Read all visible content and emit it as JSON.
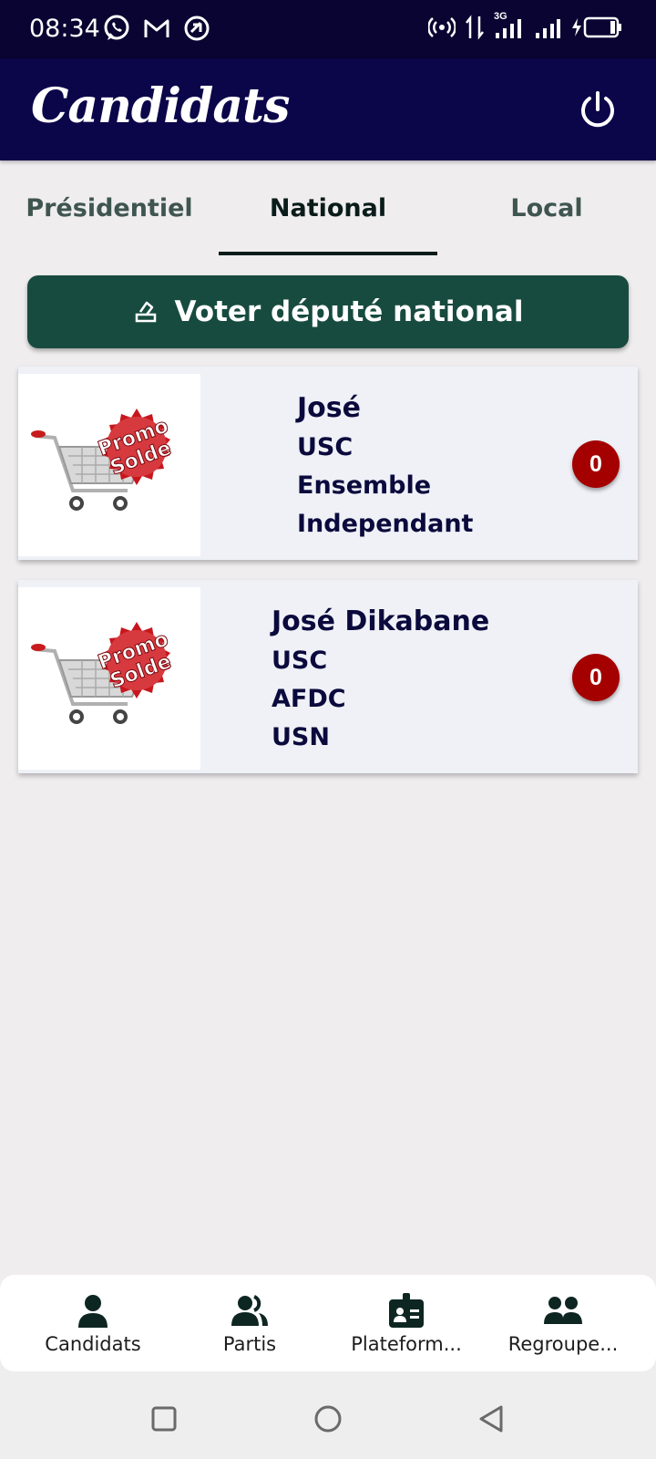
{
  "status_bar": {
    "time": "08:34",
    "network": "3G"
  },
  "app_bar": {
    "title": "Candidats"
  },
  "tabs": [
    {
      "label": "Présidentiel",
      "active": false
    },
    {
      "label": "National",
      "active": true
    },
    {
      "label": "Local",
      "active": false
    }
  ],
  "vote_button": {
    "label": "Voter député national"
  },
  "candidates": [
    {
      "name": "José",
      "lines": [
        "USC",
        "Ensemble",
        "Independant"
      ],
      "count": "0",
      "image_text": [
        "Promo",
        "Solde"
      ]
    },
    {
      "name": "José Dikabane",
      "lines": [
        "USC",
        "AFDC",
        "USN"
      ],
      "count": "0",
      "image_text": [
        "Promo",
        "Solde"
      ]
    }
  ],
  "bottom_nav": [
    {
      "label": "Candidats",
      "icon": "person-icon"
    },
    {
      "label": "Partis",
      "icon": "users-icon"
    },
    {
      "label": "Plateform...",
      "icon": "id-badge-icon"
    },
    {
      "label": "Regroupe...",
      "icon": "group-icon"
    }
  ],
  "colors": {
    "app_bar": "#0b0549",
    "status_bar": "#090431",
    "vote_button": "#184b3f",
    "badge": "#a40000",
    "card_text": "#0b0a3d",
    "tab_indicator": "#0a1c19"
  }
}
